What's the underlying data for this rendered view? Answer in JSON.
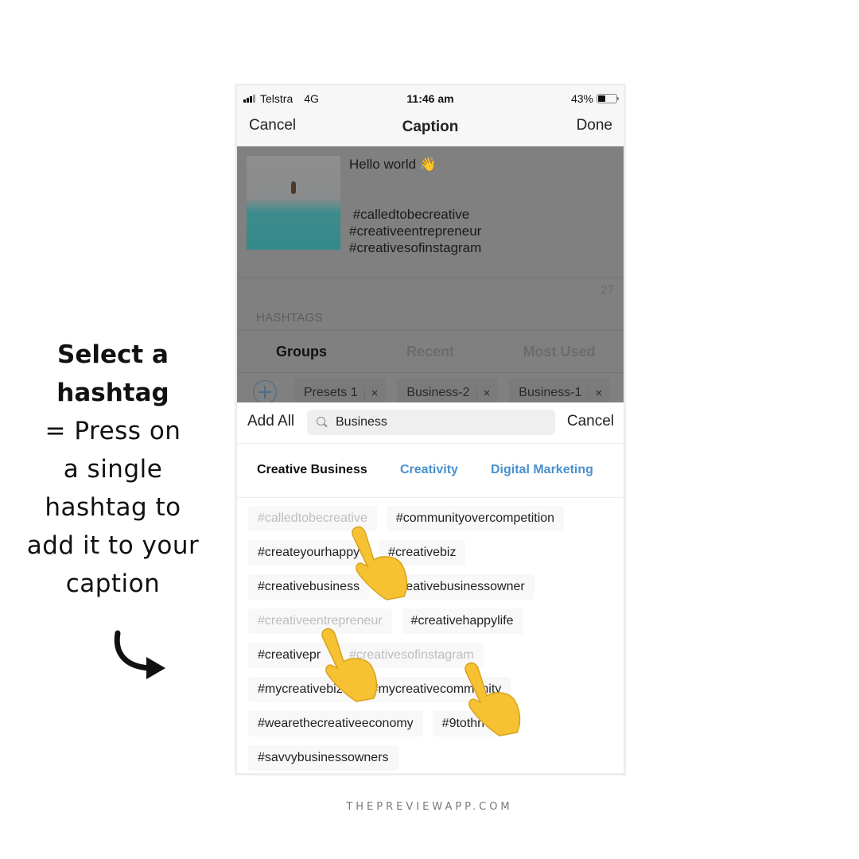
{
  "instruction": {
    "title_lines": [
      "Select a",
      "hashtag"
    ],
    "body_lines": [
      "= Press on",
      "a single",
      "hashtag to",
      "add it to your",
      "caption"
    ],
    "arrow_icon": "curved-arrow-right"
  },
  "status_bar": {
    "carrier": "Telstra",
    "network": "4G",
    "time": "11:46 am",
    "battery_percent_label": "43%",
    "battery_level": 0.43
  },
  "nav": {
    "cancel_label": "Cancel",
    "title": "Caption",
    "done_label": "Done"
  },
  "caption": {
    "first_line": "Hello world 👋",
    "hashtags": [
      " #calledtobecreative",
      "#creativeentrepreneur",
      "#creativesofinstagram"
    ],
    "char_count": "27"
  },
  "hashtags_section": {
    "label": "HASHTAGS",
    "tabs": [
      {
        "label": "Groups",
        "active": true
      },
      {
        "label": "Recent",
        "active": false
      },
      {
        "label": "Most Used",
        "active": false
      }
    ],
    "groups": [
      {
        "label": "Presets 1"
      },
      {
        "label": "Business-2"
      },
      {
        "label": "Business-1"
      }
    ],
    "remove_icon": "×"
  },
  "search": {
    "add_all_label": "Add All",
    "value": "Business",
    "cancel_label": "Cancel"
  },
  "categories": [
    {
      "label": "Creative Business",
      "active": true
    },
    {
      "label": "Creativity",
      "active": false
    },
    {
      "label": "Digital Marketing",
      "active": false
    }
  ],
  "tag_rows": [
    [
      {
        "label": "#calledtobecreative",
        "used": true
      },
      {
        "label": "#communityovercompetition",
        "used": false
      }
    ],
    [
      {
        "label": "#createyourhappy",
        "used": false
      },
      {
        "label": "#creativebiz",
        "used": false
      }
    ],
    [
      {
        "label": "#creativebusiness",
        "used": false
      },
      {
        "label": "#creativebusinessowner",
        "used": false
      }
    ],
    [
      {
        "label": "#creativeentrepreneur",
        "used": true
      },
      {
        "label": "#creativehappylife",
        "used": false
      }
    ],
    [
      {
        "label": "#creativepr",
        "used": false
      },
      {
        "label": "#creativesofinstagram",
        "used": true
      }
    ],
    [
      {
        "label": "#mycreativebiz",
        "used": false
      },
      {
        "label": "#mycreativecommunity",
        "used": false
      }
    ],
    [
      {
        "label": "#wearethecreativeeconomy",
        "used": false
      },
      {
        "label": "#9tothrive",
        "used": false
      }
    ],
    [
      {
        "label": "#savvybusinessowners",
        "used": false
      }
    ]
  ],
  "colors": {
    "accent_blue": "#4a90cf",
    "used_tag_text": "#bdbdbd",
    "overlay": "#808080",
    "hand_emoji": "#f6c234"
  },
  "footer": "THEPREVIEWAPP.COM"
}
